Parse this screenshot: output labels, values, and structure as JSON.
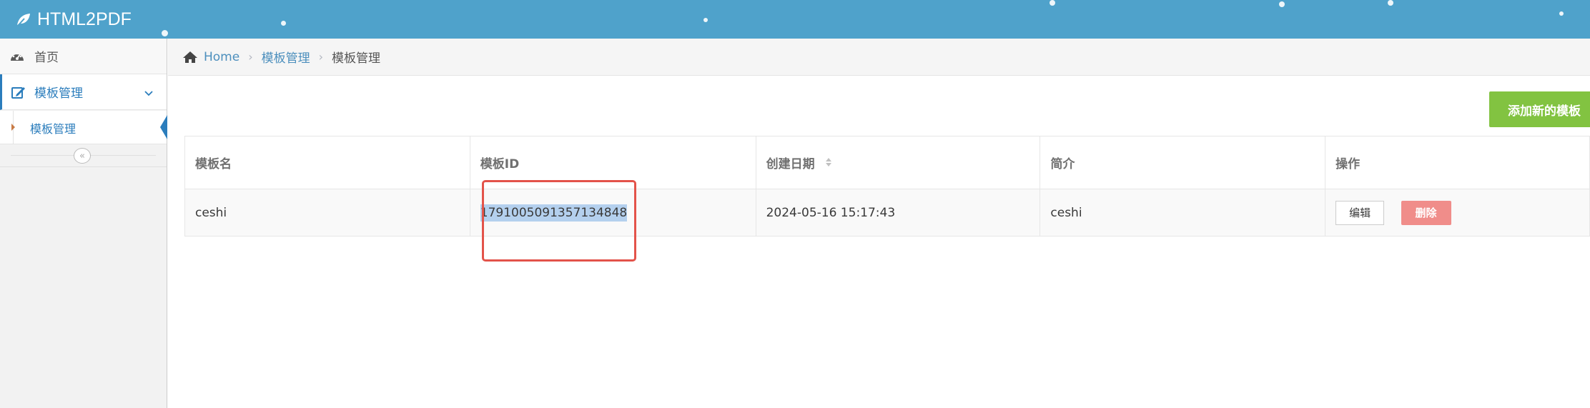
{
  "app": {
    "brand": "HTML2PDF"
  },
  "sidebar": {
    "items": [
      {
        "label": "首页",
        "icon": "dashboard-icon"
      },
      {
        "label": "模板管理",
        "icon": "edit-icon",
        "expanded": true
      }
    ],
    "submenu": [
      {
        "label": "模板管理",
        "active": true
      }
    ],
    "collapse_icon": "double-chevron-left-icon",
    "collapse_glyph": "«"
  },
  "breadcrumb": {
    "home": "Home",
    "section": "模板管理",
    "current": "模板管理"
  },
  "toolbar": {
    "add_label": "添加新的模板"
  },
  "table": {
    "headers": [
      "模板名",
      "模板ID",
      "创建日期",
      "简介",
      "操作"
    ],
    "rows": [
      {
        "name": "ceshi",
        "id": "1791005091357134848",
        "date": "2024-05-16 15:17:43",
        "desc": "ceshi",
        "edit_label": "编辑",
        "delete_label": "删除"
      }
    ]
  },
  "colors": {
    "navbar": "#4fa2cb",
    "accent": "#2b7dbc",
    "add_button": "#82c341",
    "delete_button": "#f08d8a",
    "highlight_box": "#e3534a"
  }
}
